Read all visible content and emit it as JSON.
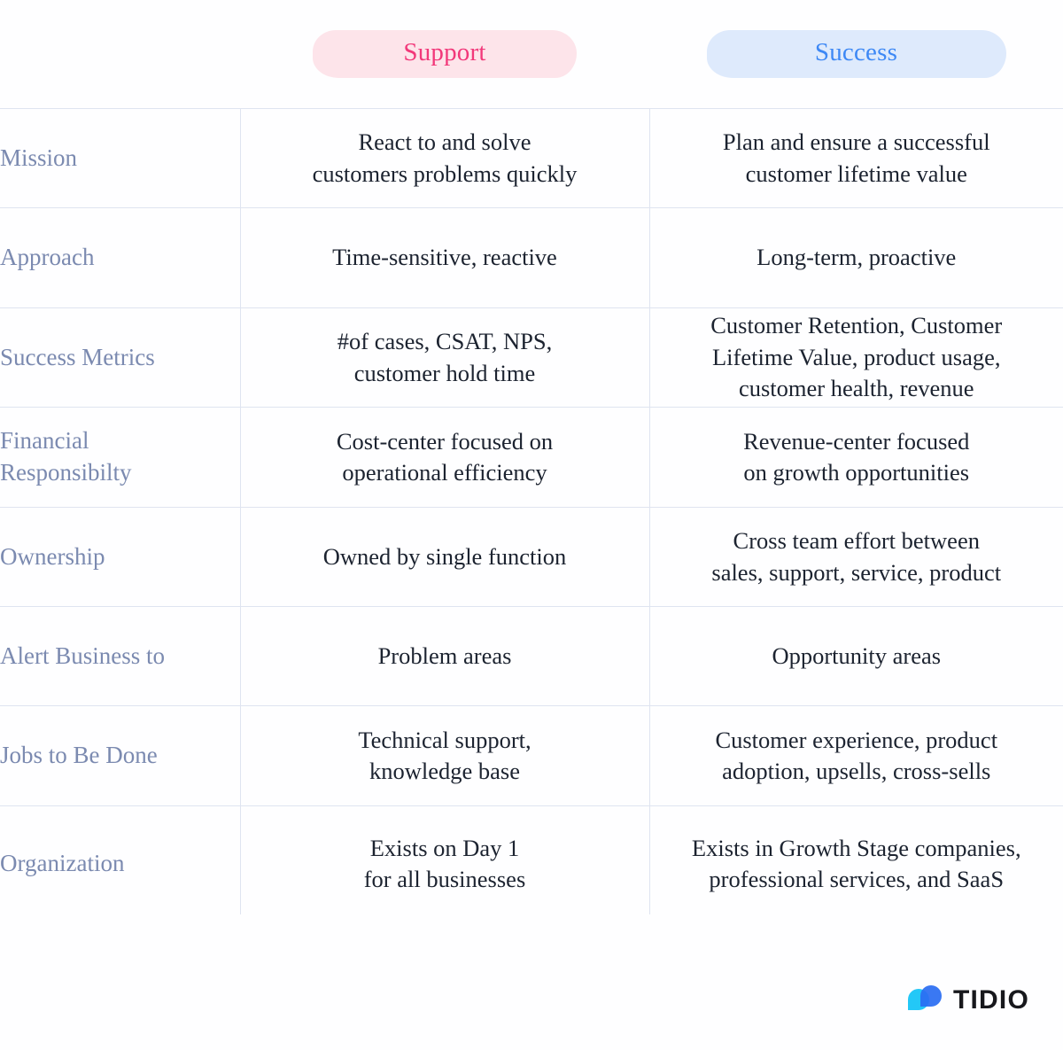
{
  "header": {
    "label_column_header": "",
    "columns": [
      {
        "id": "support",
        "label": "Support",
        "pill_bg": "#fde4ea",
        "pill_text_color": "#f2387a"
      },
      {
        "id": "success",
        "label": "Success",
        "pill_bg": "#deeafc",
        "pill_text_color": "#3d88f5"
      }
    ]
  },
  "table": {
    "rows": [
      {
        "label": "Mission",
        "support": "React to and solve\ncustomers problems quickly",
        "success": "Plan and ensure a successful\ncustomer lifetime value"
      },
      {
        "label": "Approach",
        "support": "Time-sensitive, reactive",
        "success": "Long-term, proactive"
      },
      {
        "label": "Success Metrics",
        "support": "#of cases, CSAT, NPS,\ncustomer hold time",
        "success": "Customer Retention, Customer\nLifetime Value, product usage,\ncustomer health, revenue"
      },
      {
        "label": "Financial\nResponsibilty",
        "support": "Cost-center focused on\noperational efficiency",
        "success": "Revenue-center focused\non growth opportunities"
      },
      {
        "label": "Ownership",
        "support": "Owned by single function",
        "success": "Cross team effort between\nsales, support, service, product"
      },
      {
        "label": "Alert Business to",
        "support": "Problem areas",
        "success": "Opportunity areas"
      },
      {
        "label": "Jobs to Be Done",
        "support": "Technical support,\nknowledge base",
        "success": "Customer experience, product\nadoption, upsells, cross-sells"
      },
      {
        "label": "Organization",
        "support": "Exists on Day 1\nfor all businesses",
        "success": "Exists in Growth Stage companies,\nprofessional services, and SaaS"
      }
    ]
  },
  "footer": {
    "brand": "TIDIO",
    "logo_colors": {
      "cyan": "#23c8f7",
      "blue": "#2b6ef2",
      "overlap": "#1f5ad6"
    }
  },
  "style": {
    "border_color": "#dfe4f0",
    "label_text_color": "#7b8ab0",
    "cell_text_color": "#1c2330",
    "background": "#fefeff"
  }
}
